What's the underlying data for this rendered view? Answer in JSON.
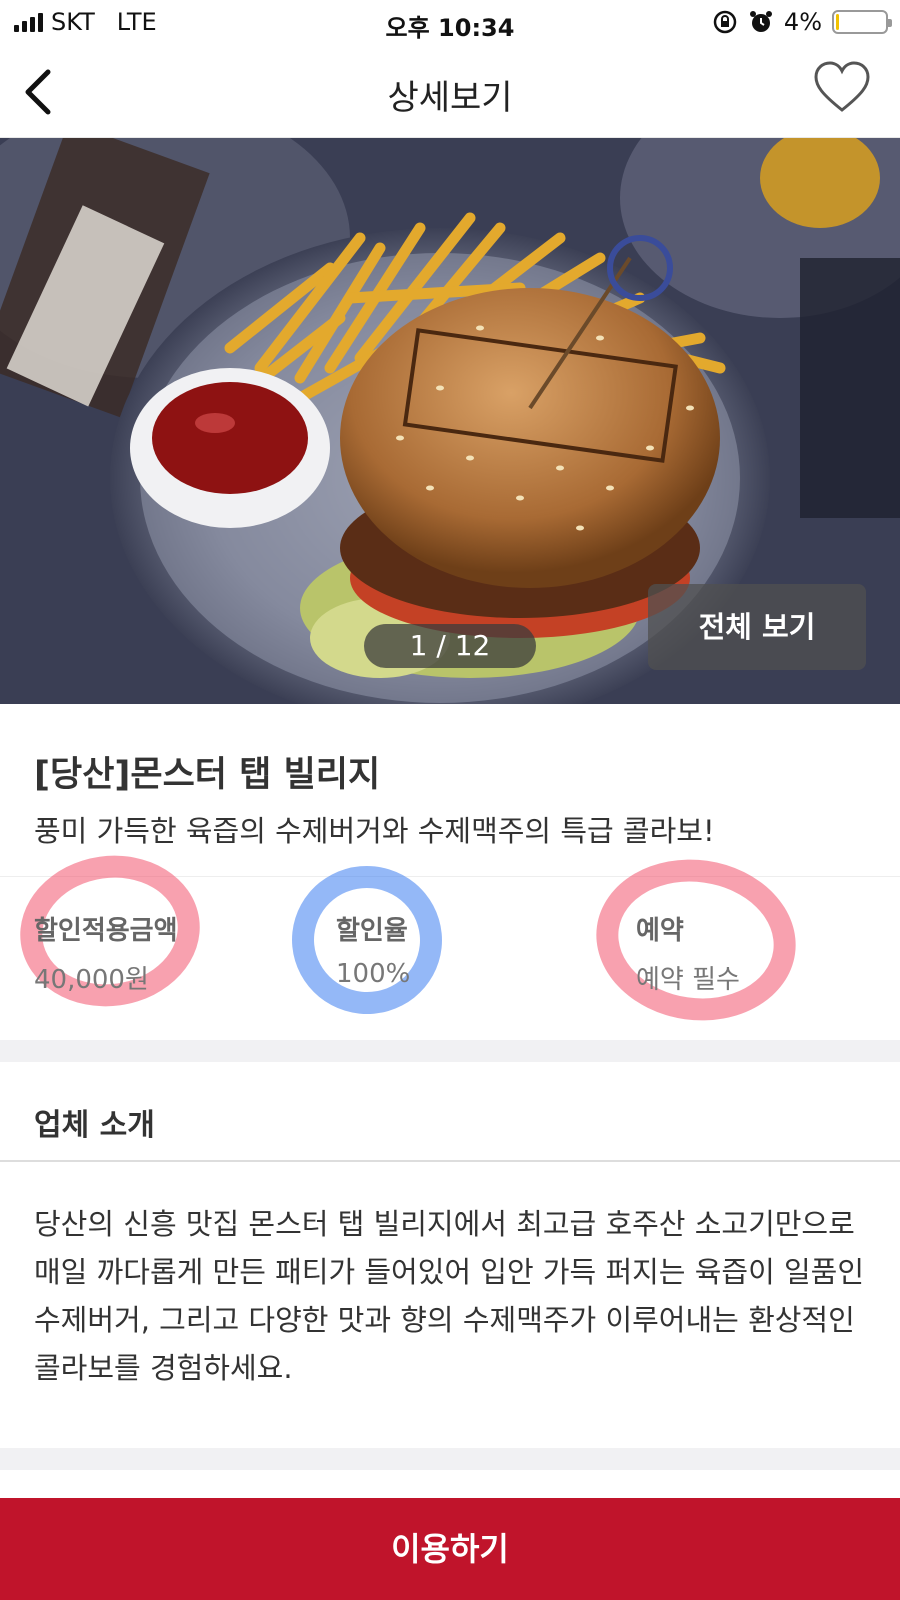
{
  "status_bar": {
    "carrier": "SKT",
    "network": "LTE",
    "time": "오후 10:34",
    "battery_percent": "4%",
    "battery_level": 0.04
  },
  "header": {
    "title": "상세보기"
  },
  "gallery": {
    "counter": "1 / 12",
    "view_all_label": "전체 보기"
  },
  "store": {
    "name": "[당산]몬스터 탭 빌리지",
    "tagline": "풍미 가득한 육즙의 수제버거와 수제맥주의 특급 콜라보!"
  },
  "stats": [
    {
      "label": "할인적용금액",
      "value": "40,000원"
    },
    {
      "label": "할인율",
      "value": "100%"
    },
    {
      "label": "예약",
      "value": "예약 필수"
    }
  ],
  "intro": {
    "title": "업체 소개",
    "body": "당산의 신흥 맛집 몬스터 탭 빌리지에서 최고급 호주산 소고기만으로 매일 까다롭게 만든 패티가 들어있어 입안 가득 퍼지는 육즙이 일품인 수제버거, 그리고 다양한 맛과 향의 수제맥주가 이루어내는 환상적인 콜라보를 경험하세요."
  },
  "cta": {
    "label": "이용하기"
  },
  "colors": {
    "cta_background": "#c0142b",
    "highlight_red": "#f2546e",
    "highlight_blue": "#3d7ef0"
  }
}
